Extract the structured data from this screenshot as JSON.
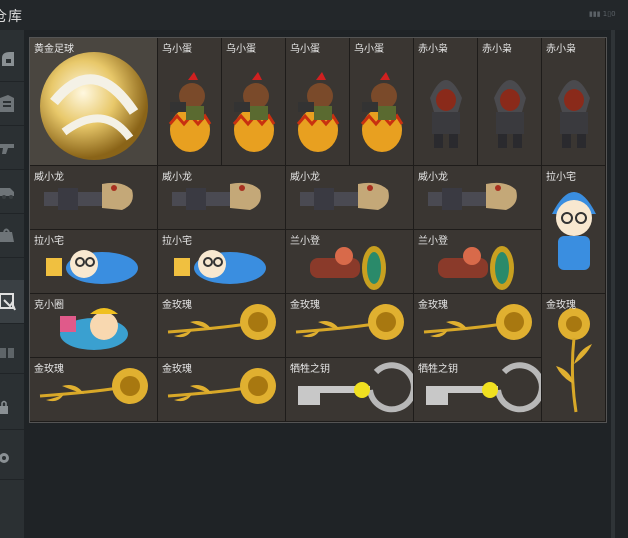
{
  "header": {
    "title": "仓库",
    "corner_text": "▮▮▮ 1▯0"
  },
  "sidebar": {
    "items": [
      {
        "icon": "helmet-icon"
      },
      {
        "icon": "armor-icon"
      },
      {
        "icon": "gun-icon"
      },
      {
        "icon": "vehicle-icon"
      },
      {
        "icon": "bag-icon"
      },
      {
        "icon": "box-icon",
        "active": true
      },
      {
        "icon": "gift-icon"
      },
      {
        "icon": "lock-icon"
      },
      {
        "icon": "gear-icon"
      }
    ]
  },
  "inventory": {
    "items": [
      {
        "name": "黄金足球",
        "type": "ball"
      },
      {
        "name": "乌小蛋",
        "type": "egg"
      },
      {
        "name": "乌小蛋",
        "type": "egg"
      },
      {
        "name": "乌小蛋",
        "type": "egg"
      },
      {
        "name": "乌小蛋",
        "type": "egg"
      },
      {
        "name": "赤小枭",
        "type": "hood"
      },
      {
        "name": "赤小枭",
        "type": "hood"
      },
      {
        "name": "赤小枭",
        "type": "hood"
      },
      {
        "name": "威小龙",
        "type": "gun"
      },
      {
        "name": "威小龙",
        "type": "gun"
      },
      {
        "name": "威小龙",
        "type": "gun"
      },
      {
        "name": "威小龙",
        "type": "gun"
      },
      {
        "name": "拉小宅",
        "type": "otaku-standing"
      },
      {
        "name": "拉小宅",
        "type": "otaku-lying"
      },
      {
        "name": "拉小宅",
        "type": "otaku-lying"
      },
      {
        "name": "兰小登",
        "type": "drum"
      },
      {
        "name": "兰小登",
        "type": "drum"
      },
      {
        "name": "克小圈",
        "type": "clown"
      },
      {
        "name": "金玫瑰",
        "type": "rose"
      },
      {
        "name": "金玫瑰",
        "type": "rose"
      },
      {
        "name": "金玫瑰",
        "type": "rose"
      },
      {
        "name": "金玫瑰",
        "type": "rose-vertical"
      },
      {
        "name": "金玫瑰",
        "type": "rose"
      },
      {
        "name": "金玫瑰",
        "type": "rose"
      },
      {
        "name": "牺牲之钥",
        "type": "key"
      },
      {
        "name": "牺牲之钥",
        "type": "key"
      }
    ]
  }
}
